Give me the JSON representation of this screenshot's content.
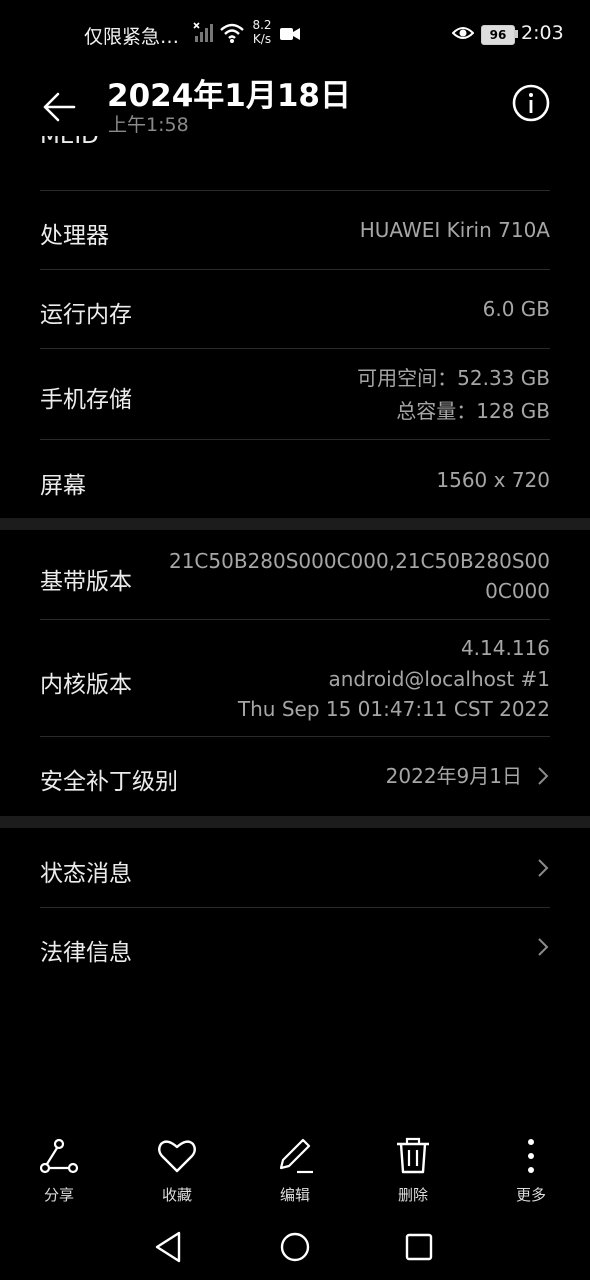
{
  "status_bar": {
    "carrier": "仅限紧急…",
    "speed_value": "8.2",
    "speed_unit": "K/s",
    "battery": "96",
    "time": "2:03"
  },
  "header": {
    "title": "2024年1月18日",
    "subtitle": "上午1:58"
  },
  "list": {
    "partial_label": "MEID",
    "rows": [
      {
        "label": "处理器",
        "value": "HUAWEI Kirin 710A"
      },
      {
        "label": "运行内存",
        "value": "6.0 GB"
      },
      {
        "label": "手机存储",
        "value_line1": "可用空间：52.33  GB",
        "value_line2": "总容量：128  GB"
      },
      {
        "label": "屏幕",
        "value": "1560 x 720"
      },
      {
        "label": "基带版本",
        "value_line1": "21C50B280S000C000,21C50B280S00",
        "value_line2": "0C000"
      },
      {
        "label": "内核版本",
        "value_line1": "4.14.116",
        "value_line2": "android@localhost #1",
        "value_line3": "Thu Sep 15 01:47:11 CST 2022"
      },
      {
        "label": "安全补丁级别",
        "value": "2022年9月1日"
      },
      {
        "label": "状态消息"
      },
      {
        "label": "法律信息"
      }
    ]
  },
  "toolbar": {
    "share": "分享",
    "favorite": "收藏",
    "edit": "编辑",
    "delete": "删除",
    "more": "更多"
  },
  "colors": {
    "background": "#000000",
    "divider": "#2a2a2a",
    "secondary_text": "#a6a6a6"
  }
}
